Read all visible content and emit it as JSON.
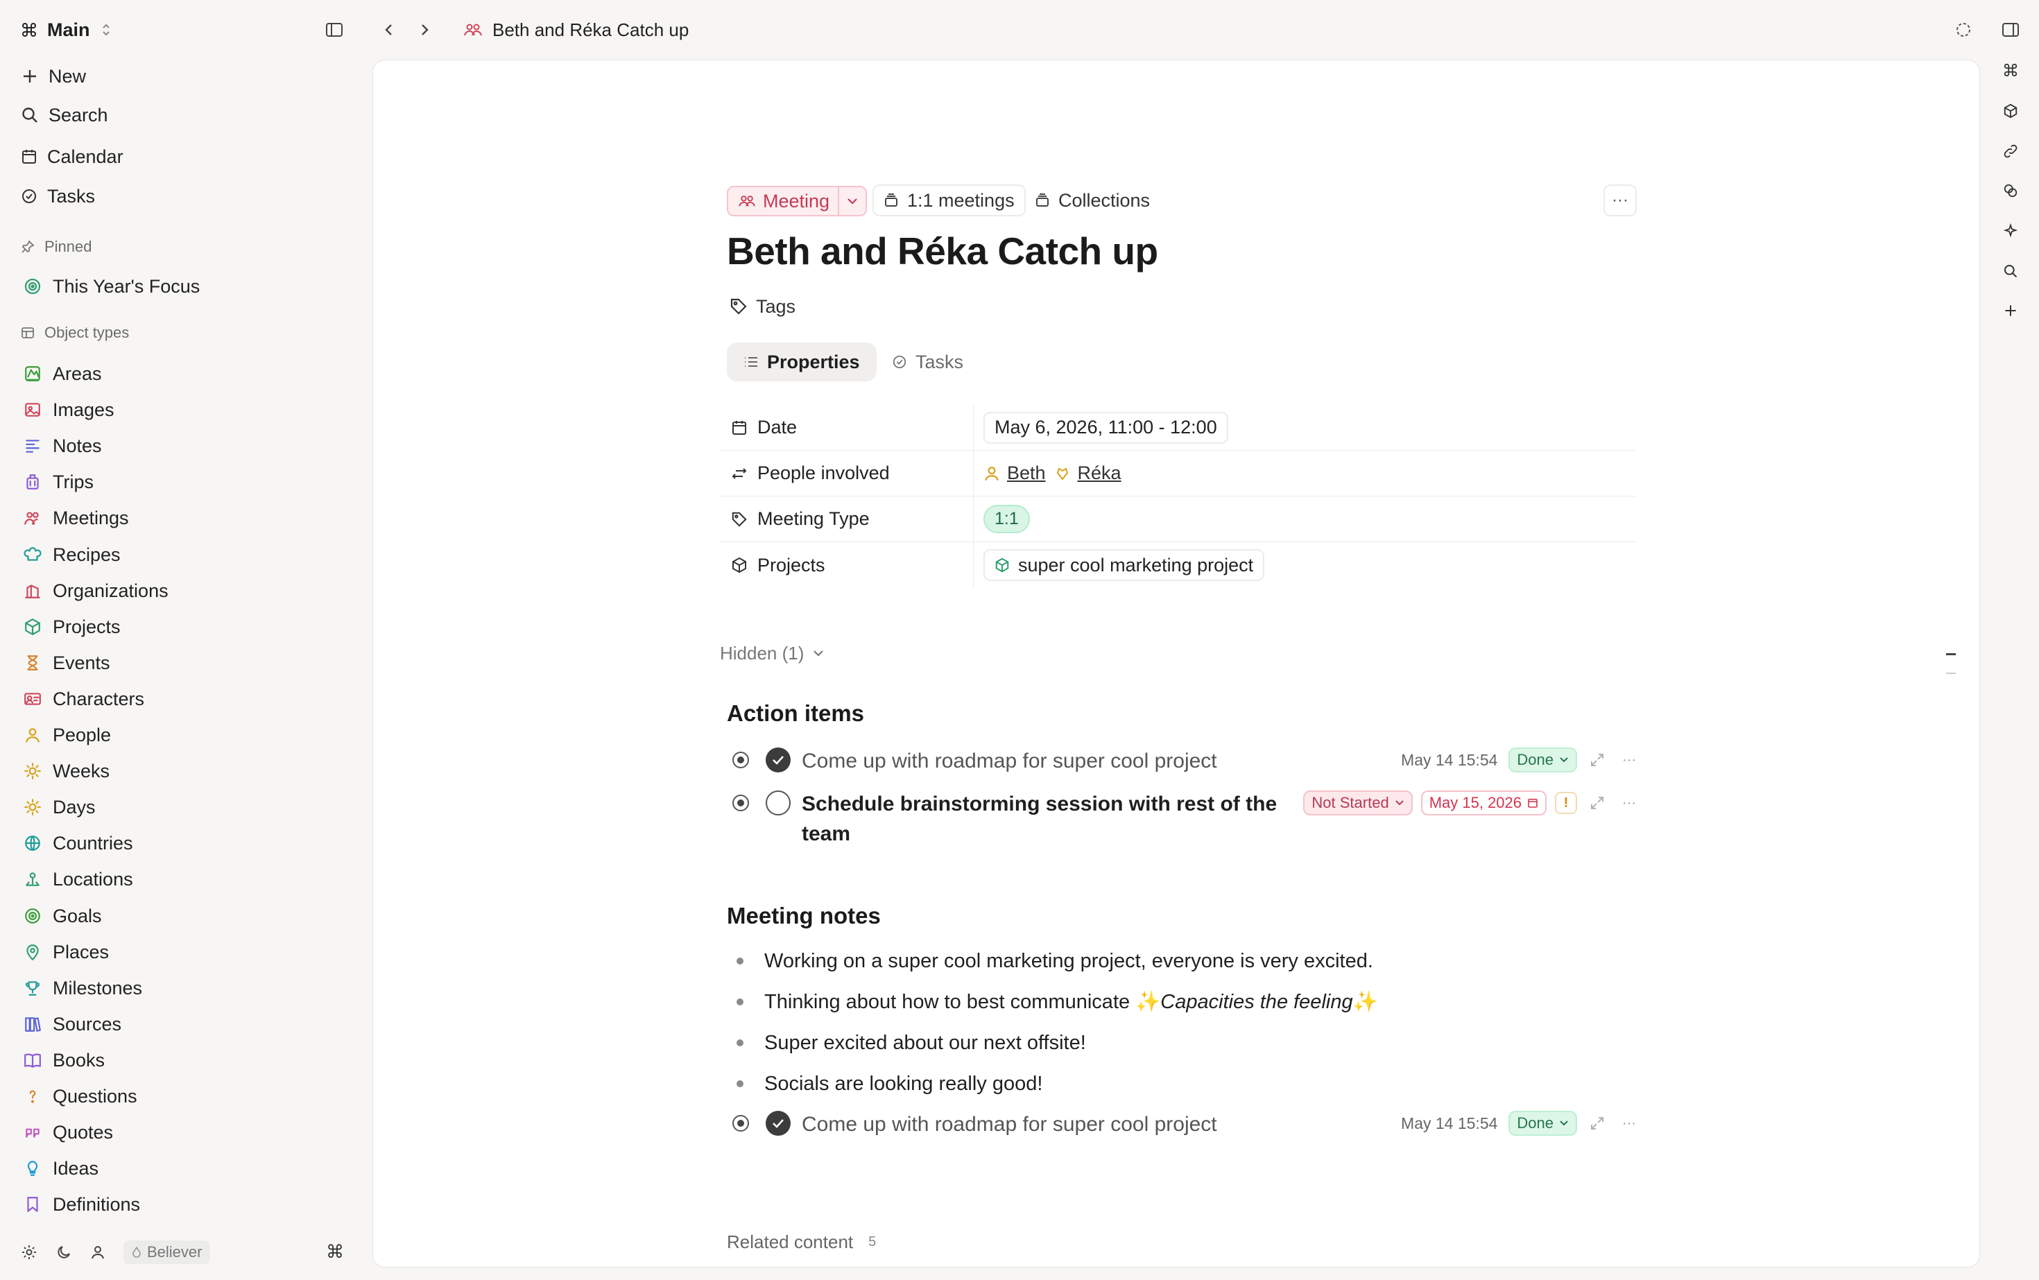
{
  "workspace": {
    "name": "Main"
  },
  "breadcrumb": {
    "title": "Beth and Réka Catch up"
  },
  "sidebar": {
    "actions": [
      {
        "label": "New",
        "icon": "plus-icon"
      },
      {
        "label": "Search",
        "icon": "search-icon"
      },
      {
        "label": "Calendar",
        "icon": "calendar-icon"
      },
      {
        "label": "Tasks",
        "icon": "task-check-icon"
      }
    ],
    "pinned_header": "Pinned",
    "pinned": [
      {
        "label": "This Year's Focus",
        "icon": "target-icon",
        "color": "#2f9e6e"
      }
    ],
    "types_header": "Object types",
    "types": [
      {
        "label": "Areas",
        "icon": "area-icon",
        "color": "#3a9d3a"
      },
      {
        "label": "Images",
        "icon": "image-icon",
        "color": "#d0465c"
      },
      {
        "label": "Notes",
        "icon": "notes-icon",
        "color": "#5b62d6"
      },
      {
        "label": "Trips",
        "icon": "luggage-icon",
        "color": "#8a5bd6"
      },
      {
        "label": "Meetings",
        "icon": "people-icon",
        "color": "#d0465c"
      },
      {
        "label": "Recipes",
        "icon": "chef-hat-icon",
        "color": "#1f9b9b"
      },
      {
        "label": "Organizations",
        "icon": "building-icon",
        "color": "#d0465c"
      },
      {
        "label": "Projects",
        "icon": "cube-icon",
        "color": "#2f9e6e"
      },
      {
        "label": "Events",
        "icon": "hourglass-icon",
        "color": "#d9822b"
      },
      {
        "label": "Characters",
        "icon": "id-card-icon",
        "color": "#d0465c"
      },
      {
        "label": "People",
        "icon": "person-icon",
        "color": "#d9a21b"
      },
      {
        "label": "Weeks",
        "icon": "sun-icon",
        "color": "#d9a21b"
      },
      {
        "label": "Days",
        "icon": "sun-icon",
        "color": "#d9a21b"
      },
      {
        "label": "Countries",
        "icon": "globe-icon",
        "color": "#1f9b9b"
      },
      {
        "label": "Locations",
        "icon": "location-icon",
        "color": "#2f9e6e"
      },
      {
        "label": "Goals",
        "icon": "target-icon",
        "color": "#3a9d3a"
      },
      {
        "label": "Places",
        "icon": "map-pin-icon",
        "color": "#2f9e6e"
      },
      {
        "label": "Milestones",
        "icon": "trophy-icon",
        "color": "#1f9b9b"
      },
      {
        "label": "Sources",
        "icon": "library-icon",
        "color": "#5b62d6"
      },
      {
        "label": "Books",
        "icon": "book-icon",
        "color": "#8a5bd6"
      },
      {
        "label": "Questions",
        "icon": "question-icon",
        "color": "#d9822b"
      },
      {
        "label": "Quotes",
        "icon": "quote-icon",
        "color": "#c455c4"
      },
      {
        "label": "Ideas",
        "icon": "bulb-icon",
        "color": "#1f9bd6"
      },
      {
        "label": "Definitions",
        "icon": "bookmark-icon",
        "color": "#8a5bd6"
      }
    ],
    "footer": {
      "badge": "Believer",
      "shortcut": "⌘"
    }
  },
  "object": {
    "type_label": "Meeting",
    "collection_1": "1:1 meetings",
    "collection_2": "Collections",
    "title": "Beth and Réka Catch up",
    "tags_label": "Tags",
    "tabs": [
      {
        "label": "Properties"
      },
      {
        "label": "Tasks"
      }
    ],
    "properties": {
      "date_label": "Date",
      "date_value": "May 6, 2026, 11:00 - 12:00",
      "people_label": "People involved",
      "person_1": "Beth",
      "person_2": "Réka",
      "type_label": "Meeting Type",
      "type_value": "1:1",
      "projects_label": "Projects",
      "project_value": "super cool marketing project"
    },
    "hidden_label": "Hidden (1)"
  },
  "action_items": {
    "heading": "Action items",
    "items": [
      {
        "text": "Come up with roadmap for super cool project",
        "timestamp": "May 14 15:54",
        "status": "Done"
      },
      {
        "text": "Schedule brainstorming session with rest of the team",
        "status": "Not Started",
        "due": "May 15, 2026",
        "priority": "!"
      }
    ]
  },
  "notes": {
    "heading": "Meeting notes",
    "bullets": [
      "Working on a super cool marketing project, everyone is very excited.",
      "Thinking about how to best communicate ",
      "Super excited about our next offsite!",
      "Socials are looking really good!"
    ],
    "bullet_2_emph": "Capacities the feeling",
    "task": {
      "text": "Come up with roadmap for super cool project",
      "timestamp": "May 14 15:54",
      "status": "Done"
    }
  },
  "related": {
    "label": "Related content",
    "count": "5"
  },
  "colors": {
    "accent_pink": "#c43b55",
    "success_green": "#26744c",
    "text": "#1f1f1f"
  }
}
